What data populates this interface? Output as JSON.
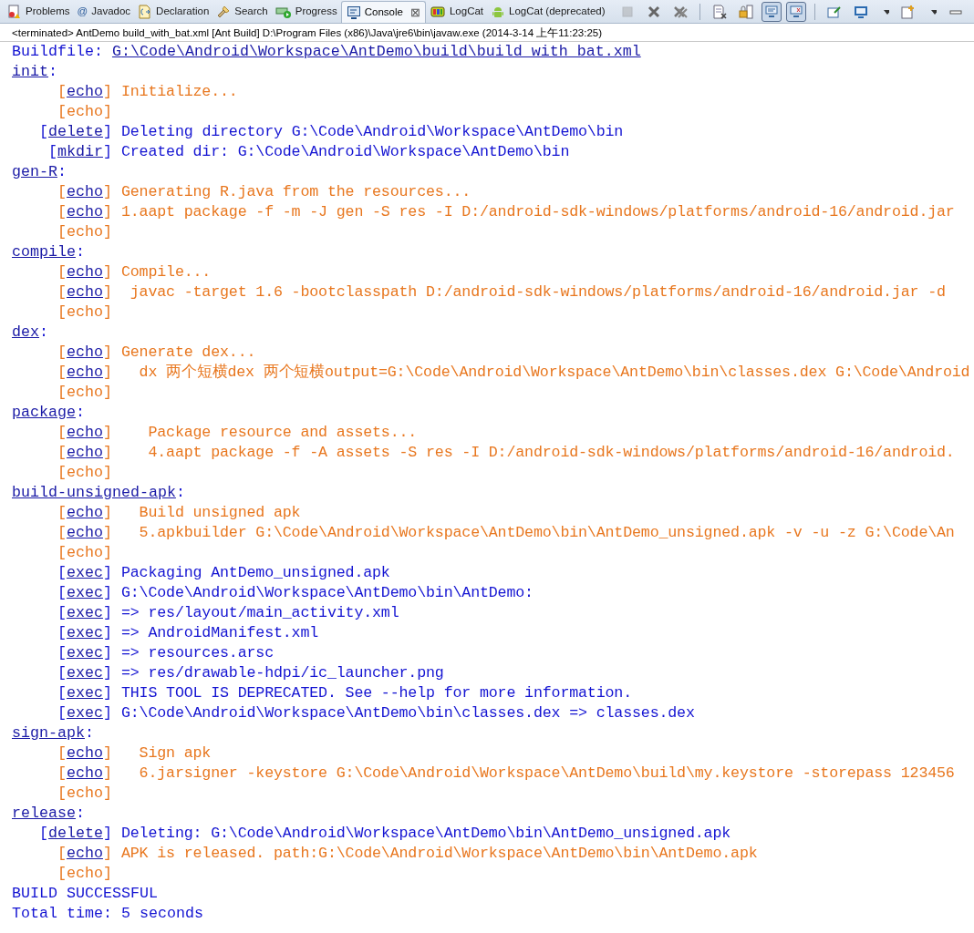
{
  "tabs": [
    {
      "label": "Problems",
      "selected": false
    },
    {
      "label": "Javadoc",
      "glyph": "@",
      "selected": false
    },
    {
      "label": "Declaration",
      "selected": false
    },
    {
      "label": "Search",
      "selected": false
    },
    {
      "label": "Progress",
      "selected": false
    },
    {
      "label": "Console",
      "selected": true,
      "close": "⊠"
    },
    {
      "label": "LogCat",
      "selected": false
    },
    {
      "label": "LogCat (deprecated)",
      "selected": false
    }
  ],
  "toolbar": [
    {
      "kind": "stop",
      "disabled": true,
      "pressed": false
    },
    {
      "kind": "remove",
      "disabled": false,
      "pressed": false
    },
    {
      "kind": "remove-all",
      "disabled": false,
      "pressed": false
    },
    {
      "kind": "separator",
      "disabled": false,
      "pressed": false
    },
    {
      "kind": "clear",
      "disabled": false,
      "pressed": false
    },
    {
      "kind": "lock",
      "disabled": false,
      "pressed": false
    },
    {
      "kind": "stdout",
      "disabled": false,
      "pressed": true
    },
    {
      "kind": "stderr",
      "disabled": false,
      "pressed": true
    },
    {
      "kind": "separator",
      "disabled": false,
      "pressed": false
    },
    {
      "kind": "pin",
      "disabled": false,
      "pressed": false
    },
    {
      "kind": "display",
      "disabled": false,
      "pressed": false
    },
    {
      "kind": "dropdown",
      "disabled": false,
      "pressed": false
    },
    {
      "kind": "open",
      "disabled": false,
      "pressed": false
    },
    {
      "kind": "dropdown",
      "disabled": false,
      "pressed": false
    },
    {
      "kind": "minimize",
      "disabled": false,
      "pressed": false
    }
  ],
  "process": "<terminated> AntDemo build_with_bat.xml [Ant Build] D:\\Program Files (x86)\\Java\\jre6\\bin\\javaw.exe (2014-3-14 上午11:23:25)",
  "lines": [
    {
      "kind": "buildfile",
      "label": "Buildfile: ",
      "link": "G:\\Code\\Android\\Workspace\\AntDemo\\build\\build_with_bat.xml"
    },
    {
      "kind": "target",
      "name": "init",
      "suffix": ":"
    },
    {
      "kind": "task",
      "open": "[",
      "task": "echo",
      "close": "]",
      "linked": true,
      "color": "#e8771f",
      "message": "Initialize..."
    },
    {
      "kind": "task",
      "open": "[",
      "task": "echo",
      "close": "]",
      "linked": false,
      "color": "#e8771f"
    },
    {
      "kind": "task",
      "open": "[",
      "task": "delete",
      "close": "]",
      "linked": true,
      "color": "#1414d2",
      "message": "Deleting directory G:\\Code\\Android\\Workspace\\AntDemo\\bin"
    },
    {
      "kind": "task",
      "open": "[",
      "task": "mkdir",
      "close": "]",
      "linked": true,
      "color": "#1414d2",
      "message": "Created dir: G:\\Code\\Android\\Workspace\\AntDemo\\bin"
    },
    {
      "kind": "target",
      "name": "gen-R",
      "suffix": ":"
    },
    {
      "kind": "task",
      "open": "[",
      "task": "echo",
      "close": "]",
      "linked": true,
      "color": "#e8771f",
      "message": "Generating R.java from the resources..."
    },
    {
      "kind": "task",
      "open": "[",
      "task": "echo",
      "close": "]",
      "linked": true,
      "color": "#e8771f",
      "message": "1.aapt package -f -m -J gen -S res -I D:/android-sdk-windows/platforms/android-16/android.jar"
    },
    {
      "kind": "task",
      "open": "[",
      "task": "echo",
      "close": "]",
      "linked": false,
      "color": "#e8771f"
    },
    {
      "kind": "target",
      "name": "compile",
      "suffix": ":"
    },
    {
      "kind": "task",
      "open": "[",
      "task": "echo",
      "close": "]",
      "linked": true,
      "color": "#e8771f",
      "message": "Compile..."
    },
    {
      "kind": "task",
      "open": "[",
      "task": "echo",
      "close": "]",
      "linked": true,
      "color": "#e8771f",
      "message": " javac -target 1.6 -bootclasspath D:/android-sdk-windows/platforms/android-16/android.jar -d"
    },
    {
      "kind": "task",
      "open": "[",
      "task": "echo",
      "close": "]",
      "linked": false,
      "color": "#e8771f"
    },
    {
      "kind": "target",
      "name": "dex",
      "suffix": ":"
    },
    {
      "kind": "task",
      "open": "[",
      "task": "echo",
      "close": "]",
      "linked": true,
      "color": "#e8771f",
      "message": "Generate dex..."
    },
    {
      "kind": "task",
      "open": "[",
      "task": "echo",
      "close": "]",
      "linked": true,
      "color": "#e8771f",
      "message": "  dx 两个短横dex 两个短横output=G:\\Code\\Android\\Workspace\\AntDemo\\bin\\classes.dex G:\\Code\\Android"
    },
    {
      "kind": "task",
      "open": "[",
      "task": "echo",
      "close": "]",
      "linked": false,
      "color": "#e8771f"
    },
    {
      "kind": "target",
      "name": "package",
      "suffix": ":"
    },
    {
      "kind": "task",
      "open": "[",
      "task": "echo",
      "close": "]",
      "linked": true,
      "color": "#e8771f",
      "message": "   Package resource and assets..."
    },
    {
      "kind": "task",
      "open": "[",
      "task": "echo",
      "close": "]",
      "linked": true,
      "color": "#e8771f",
      "message": "   4.aapt package -f -A assets -S res -I D:/android-sdk-windows/platforms/android-16/android."
    },
    {
      "kind": "task",
      "open": "[",
      "task": "echo",
      "close": "]",
      "linked": false,
      "color": "#e8771f"
    },
    {
      "kind": "target",
      "name": "build-unsigned-apk",
      "suffix": ":"
    },
    {
      "kind": "task",
      "open": "[",
      "task": "echo",
      "close": "]",
      "linked": true,
      "color": "#e8771f",
      "message": "  Build unsigned apk"
    },
    {
      "kind": "task",
      "open": "[",
      "task": "echo",
      "close": "]",
      "linked": true,
      "color": "#e8771f",
      "message": "  5.apkbuilder G:\\Code\\Android\\Workspace\\AntDemo\\bin\\AntDemo_unsigned.apk -v -u -z G:\\Code\\An"
    },
    {
      "kind": "task",
      "open": "[",
      "task": "echo",
      "close": "]",
      "linked": false,
      "color": "#e8771f"
    },
    {
      "kind": "task",
      "open": "[",
      "task": "exec",
      "close": "]",
      "linked": true,
      "color": "#1414d2",
      "message": "Packaging AntDemo_unsigned.apk"
    },
    {
      "kind": "task",
      "open": "[",
      "task": "exec",
      "close": "]",
      "linked": true,
      "color": "#1414d2",
      "message": "G:\\Code\\Android\\Workspace\\AntDemo\\bin\\AntDemo:"
    },
    {
      "kind": "task",
      "open": "[",
      "task": "exec",
      "close": "]",
      "linked": true,
      "color": "#1414d2",
      "message": "=> res/layout/main_activity.xml"
    },
    {
      "kind": "task",
      "open": "[",
      "task": "exec",
      "close": "]",
      "linked": true,
      "color": "#1414d2",
      "message": "=> AndroidManifest.xml"
    },
    {
      "kind": "task",
      "open": "[",
      "task": "exec",
      "close": "]",
      "linked": true,
      "color": "#1414d2",
      "message": "=> resources.arsc"
    },
    {
      "kind": "task",
      "open": "[",
      "task": "exec",
      "close": "]",
      "linked": true,
      "color": "#1414d2",
      "message": "=> res/drawable-hdpi/ic_launcher.png"
    },
    {
      "kind": "task",
      "open": "[",
      "task": "exec",
      "close": "]",
      "linked": true,
      "color": "#1414d2",
      "message": "THIS TOOL IS DEPRECATED. See --help for more information."
    },
    {
      "kind": "task",
      "open": "[",
      "task": "exec",
      "close": "]",
      "linked": true,
      "color": "#1414d2",
      "message": "G:\\Code\\Android\\Workspace\\AntDemo\\bin\\classes.dex => classes.dex"
    },
    {
      "kind": "target",
      "name": "sign-apk",
      "suffix": ":"
    },
    {
      "kind": "task",
      "open": "[",
      "task": "echo",
      "close": "]",
      "linked": true,
      "color": "#e8771f",
      "message": "  Sign apk"
    },
    {
      "kind": "task",
      "open": "[",
      "task": "echo",
      "close": "]",
      "linked": true,
      "color": "#e8771f",
      "message": "  6.jarsigner -keystore G:\\Code\\Android\\Workspace\\AntDemo\\build\\my.keystore -storepass 123456"
    },
    {
      "kind": "task",
      "open": "[",
      "task": "echo",
      "close": "]",
      "linked": false,
      "color": "#e8771f"
    },
    {
      "kind": "target",
      "name": "release",
      "suffix": ":"
    },
    {
      "kind": "task",
      "open": "[",
      "task": "delete",
      "close": "]",
      "linked": true,
      "color": "#1414d2",
      "message": "Deleting: G:\\Code\\Android\\Workspace\\AntDemo\\bin\\AntDemo_unsigned.apk"
    },
    {
      "kind": "task",
      "open": "[",
      "task": "echo",
      "close": "]",
      "linked": true,
      "color": "#e8771f",
      "message": "APK is released. path:G:\\Code\\Android\\Workspace\\AntDemo\\bin\\AntDemo.apk"
    },
    {
      "kind": "task",
      "open": "[",
      "task": "echo",
      "close": "]",
      "linked": false,
      "color": "#e8771f"
    },
    {
      "kind": "plain",
      "text": "BUILD SUCCESSFUL"
    },
    {
      "kind": "plain",
      "text": "Total time: 5 seconds"
    }
  ]
}
